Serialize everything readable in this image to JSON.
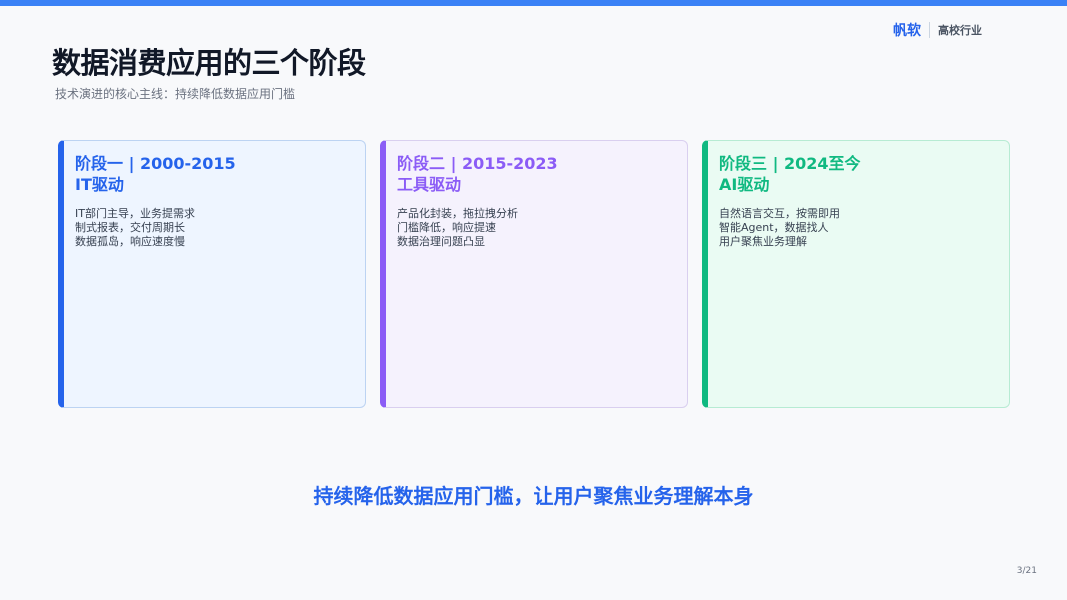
{
  "brand": {
    "name": "帆软",
    "sub": "高校行业"
  },
  "header": {
    "title": "数据消费应用的三个阶段",
    "subtitle": "技术演进的核心主线：持续降低数据应用门槛"
  },
  "stages": [
    {
      "head_line1": "阶段一 | 2000-2015",
      "head_line2": "IT驱动",
      "points": [
        "IT部门主导，业务提需求",
        "制式报表，交付周期长",
        "数据孤岛，响应速度慢"
      ],
      "accent": "#2563eb"
    },
    {
      "head_line1": "阶段二 | 2015-2023",
      "head_line2": "工具驱动",
      "points": [
        "产品化封装，拖拉拽分析",
        "门槛降低，响应提速",
        "数据治理问题凸显"
      ],
      "accent": "#8b5cf6"
    },
    {
      "head_line1": "阶段三 | 2024至今",
      "head_line2": "AI驱动",
      "points": [
        "自然语言交互，按需即用",
        "智能Agent，数据找人",
        "用户聚焦业务理解"
      ],
      "accent": "#10b981"
    }
  ],
  "conclusion": "持续降低数据应用门槛，让用户聚焦业务理解本身",
  "page_number": "3/21",
  "colors": {
    "top_bar": "#3b82f6",
    "brand": "#2563eb"
  }
}
